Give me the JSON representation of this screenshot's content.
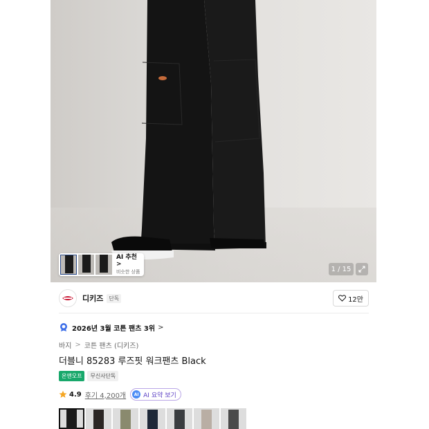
{
  "gallery": {
    "counter": "1 / 15",
    "ai_recommend_title": "AI 추천 >",
    "ai_recommend_sub": "비슷한 상품"
  },
  "brand": {
    "name": "디키즈",
    "exclusive_tag": "단독",
    "like_count": "12만"
  },
  "rank": {
    "text": "2026년 3월 코튼 팬츠 3위",
    "chevron": ">"
  },
  "breadcrumb": {
    "items": [
      "바지",
      "코튼 팬츠 (디키즈)"
    ],
    "separator": ">"
  },
  "product": {
    "title": "더블니 85283 루즈핏 워크팬츠 Black",
    "badge_offline": "온앤오프",
    "badge_exclusive": "무신사단독"
  },
  "rating": {
    "score": "4.9",
    "reviews_label": "후기 4,200개",
    "ai_badge": "AI",
    "ai_summary_label": "AI 요약 보기"
  },
  "colors": {
    "accent_green": "#18a86b",
    "ai_purple": "#5b3fc4",
    "star": "#f5a623",
    "swatches": [
      "#1b1b1b",
      "#2b2624",
      "#8a8a6e",
      "#1e2838",
      "#3a3d40",
      "#b9aea4",
      "#4a4a4a"
    ]
  }
}
